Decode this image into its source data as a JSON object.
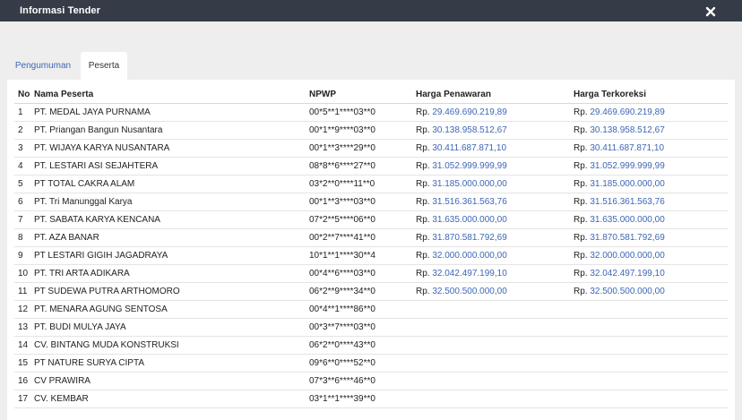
{
  "window": {
    "title": "Informasi Tender",
    "close_icon": "close-x-icon"
  },
  "tabs": [
    {
      "label": "Pengumuman",
      "active": false
    },
    {
      "label": "Peserta",
      "active": true
    }
  ],
  "table": {
    "headers": [
      "No",
      "Nama Peserta",
      "NPWP",
      "Harga Penawaran",
      "Harga Terkoreksi"
    ],
    "currency_prefix": "Rp.",
    "rows": [
      {
        "no": "1",
        "nama": "PT. MEDAL JAYA PURNAMA",
        "npwp": "00*5**1****03**0",
        "penawaran": "29.469.690.219,89",
        "terkoreksi": "29.469.690.219,89"
      },
      {
        "no": "2",
        "nama": "PT. Priangan Bangun Nusantara",
        "npwp": "00*1**9****03**0",
        "penawaran": "30.138.958.512,67",
        "terkoreksi": "30.138.958.512,67"
      },
      {
        "no": "3",
        "nama": "PT. WIJAYA KARYA NUSANTARA",
        "npwp": "00*1**3****29**0",
        "penawaran": "30.411.687.871,10",
        "terkoreksi": "30.411.687.871,10"
      },
      {
        "no": "4",
        "nama": "PT. LESTARI ASI SEJAHTERA",
        "npwp": "08*8**6****27**0",
        "penawaran": "31.052.999.999,99",
        "terkoreksi": "31.052.999.999,99"
      },
      {
        "no": "5",
        "nama": "PT TOTAL CAKRA ALAM",
        "npwp": "03*2**0****11**0",
        "penawaran": "31.185.000.000,00",
        "terkoreksi": "31.185.000.000,00"
      },
      {
        "no": "6",
        "nama": "PT. Tri Manunggal Karya",
        "npwp": "00*1**3****03**0",
        "penawaran": "31.516.361.563,76",
        "terkoreksi": "31.516.361.563,76"
      },
      {
        "no": "7",
        "nama": "PT. SABATA KARYA KENCANA",
        "npwp": "07*2**5****06**0",
        "penawaran": "31.635.000.000,00",
        "terkoreksi": "31.635.000.000,00"
      },
      {
        "no": "8",
        "nama": "PT. AZA BANAR",
        "npwp": "00*2**7****41**0",
        "penawaran": "31.870.581.792,69",
        "terkoreksi": "31.870.581.792,69"
      },
      {
        "no": "9",
        "nama": "PT LESTARI GIGIH JAGADRAYA",
        "npwp": "10*1**1****30**4",
        "penawaran": "32.000.000.000,00",
        "terkoreksi": "32.000.000.000,00"
      },
      {
        "no": "10",
        "nama": "PT. TRI ARTA ADIKARA",
        "npwp": "00*4**6****03**0",
        "penawaran": "32.042.497.199,10",
        "terkoreksi": "32.042.497.199,10"
      },
      {
        "no": "11",
        "nama": "PT SUDEWA PUTRA ARTHOMORO",
        "npwp": "06*2**9****34**0",
        "penawaran": "32.500.500.000,00",
        "terkoreksi": "32.500.500.000,00"
      },
      {
        "no": "12",
        "nama": "PT. MENARA AGUNG SENTOSA",
        "npwp": "00*4**1****86**0",
        "penawaran": "",
        "terkoreksi": ""
      },
      {
        "no": "13",
        "nama": "PT. BUDI MULYA JAYA",
        "npwp": "00*3**7****03**0",
        "penawaran": "",
        "terkoreksi": ""
      },
      {
        "no": "14",
        "nama": "CV. BINTANG MUDA KONSTRUKSI",
        "npwp": "06*2**0****43**0",
        "penawaran": "",
        "terkoreksi": ""
      },
      {
        "no": "15",
        "nama": "PT NATURE SURYA CIPTA",
        "npwp": "09*6**0****52**0",
        "penawaran": "",
        "terkoreksi": ""
      },
      {
        "no": "16",
        "nama": "CV PRAWIRA",
        "npwp": "07*3**6****46**0",
        "penawaran": "",
        "terkoreksi": ""
      },
      {
        "no": "17",
        "nama": "CV. KEMBAR",
        "npwp": "03*1**1****39**0",
        "penawaran": "",
        "terkoreksi": ""
      }
    ]
  },
  "colors": {
    "titlebar": "#353c48",
    "link": "#3d67b5",
    "background": "#eeeeee"
  }
}
